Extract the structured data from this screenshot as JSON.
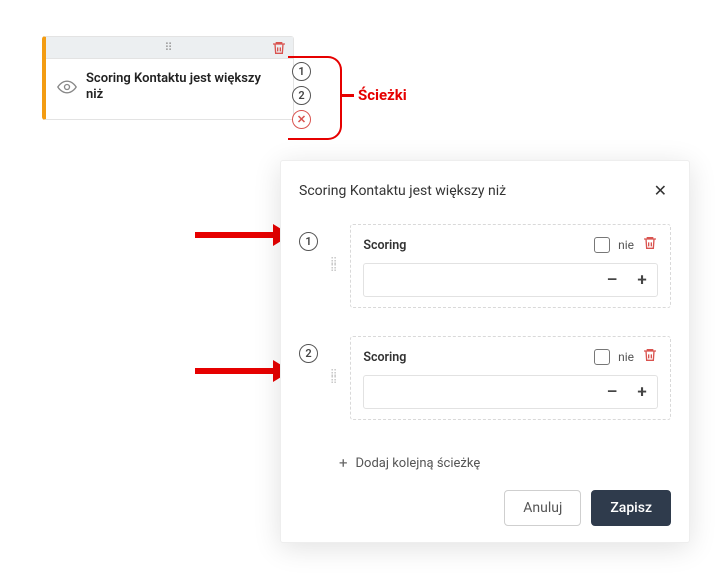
{
  "card": {
    "title": "Scoring Kontaktu jest większy niż",
    "outlets": [
      "1",
      "2"
    ]
  },
  "annotation": {
    "paths_label": "Ścieżki"
  },
  "panel": {
    "title": "Scoring Kontaktu jest większy niż",
    "paths": [
      {
        "index": "1",
        "field_label": "Scoring",
        "negate_label": "nie",
        "negate_checked": false,
        "value": ""
      },
      {
        "index": "2",
        "field_label": "Scoring",
        "negate_label": "nie",
        "negate_checked": false,
        "value": ""
      }
    ],
    "add_label": "Dodaj kolejną ścieżkę",
    "cancel_label": "Anuluj",
    "save_label": "Zapisz"
  }
}
